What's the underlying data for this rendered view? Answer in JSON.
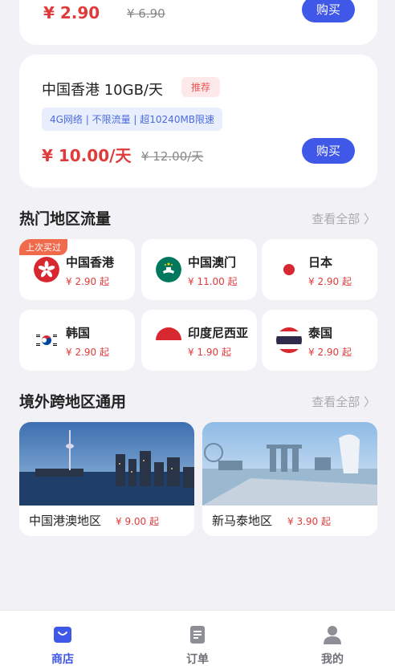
{
  "top_card": {
    "price": "¥ 2.90",
    "old_price": "¥ 6.90",
    "buy_label": "购买"
  },
  "hk_card": {
    "title": "中国香港 10GB/天",
    "tag": "推荐",
    "features": "4G网络 | 不限流量 | 超10240MB限速",
    "price": "¥ 10.00/天",
    "old_price": "¥ 12.00/天",
    "buy_label": "购买"
  },
  "popular": {
    "title": "热门地区流量",
    "see_all": "查看全部 〉",
    "last_buy_badge": "上次买过",
    "items": [
      {
        "name": "中国香港",
        "price": "¥ 2.90 起",
        "flag": "hong-kong-flag-icon"
      },
      {
        "name": "中国澳门",
        "price": "¥ 11.00 起",
        "flag": "macau-flag-icon"
      },
      {
        "name": "日本",
        "price": "¥ 2.90 起",
        "flag": "japan-flag-icon"
      },
      {
        "name": "韩国",
        "price": "¥ 2.90 起",
        "flag": "korea-flag-icon"
      },
      {
        "name": "印度尼西亚",
        "price": "¥ 1.90 起",
        "flag": "indonesia-flag-icon"
      },
      {
        "name": "泰国",
        "price": "¥ 2.90 起",
        "flag": "thailand-flag-icon"
      }
    ]
  },
  "cross": {
    "title": "境外跨地区通用",
    "see_all": "查看全部 〉",
    "items": [
      {
        "name": "中国港澳地区",
        "price": "¥ 9.00 起"
      },
      {
        "name": "新马泰地区",
        "price": "¥ 3.90 起"
      }
    ]
  },
  "tabbar": {
    "active_color": "#4058e8",
    "items": [
      {
        "label": "商店",
        "icon": "shop-icon"
      },
      {
        "label": "订单",
        "icon": "order-icon"
      },
      {
        "label": "我的",
        "icon": "profile-icon"
      }
    ]
  }
}
